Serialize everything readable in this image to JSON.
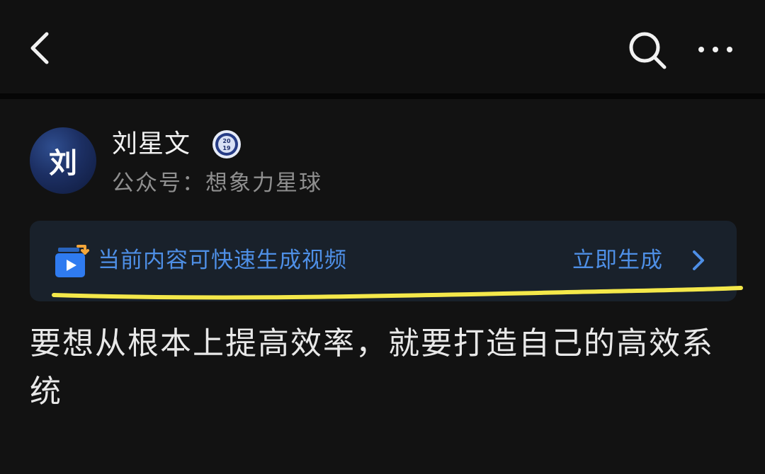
{
  "author": {
    "avatar_char": "刘",
    "name": "刘星文",
    "badge_text": "2019",
    "account": "公众号：想象力星球"
  },
  "banner": {
    "text": "当前内容可快速生成视频",
    "action": "立即生成"
  },
  "article": {
    "title": "要想从根本上提高效率，就要打造自己的高效系统"
  },
  "icons": {
    "back": "chevron-left-icon",
    "search": "search-icon",
    "more": "more-dots-icon",
    "badge": "year-badge-icon",
    "video": "video-generate-icon",
    "chevron": "chevron-right-icon"
  },
  "colors": {
    "background": "#121212",
    "accent_blue": "#4e8fe6",
    "banner_bg": "#19212b",
    "highlight": "#f4e84a",
    "title_text": "#e8e8e8",
    "secondary_text": "#8f8f8f"
  }
}
